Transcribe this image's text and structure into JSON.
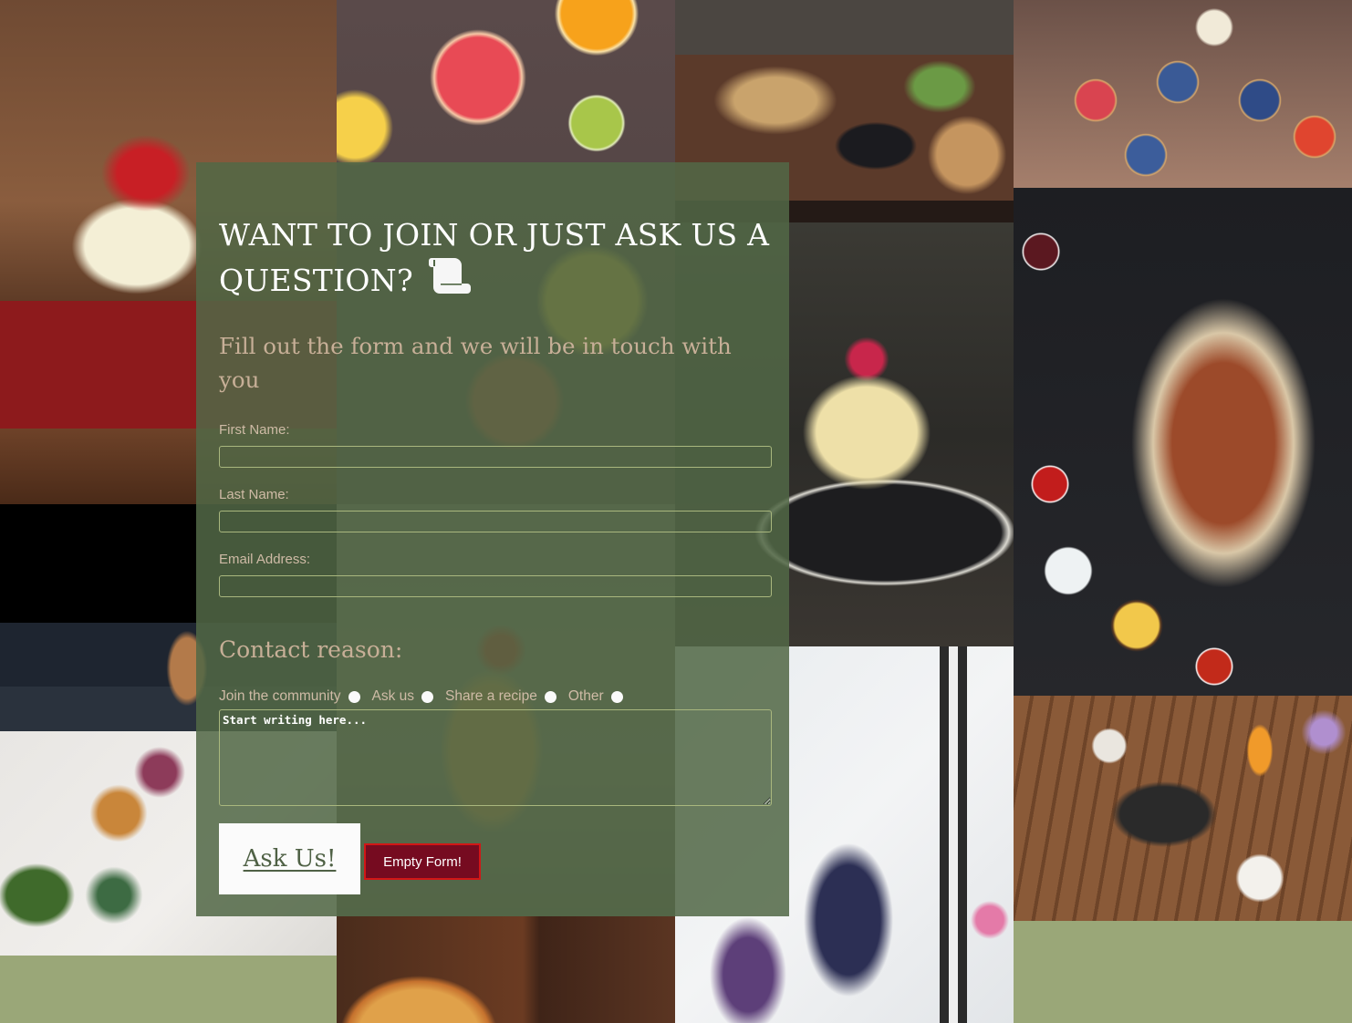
{
  "background": {
    "fill_color": "#9aa778",
    "tiles": [
      {
        "name": "red-velvet-cupcake-photo"
      },
      {
        "name": "burger-photo"
      },
      {
        "name": "breakfast-spread-photo"
      },
      {
        "name": "citrus-slices-photo"
      },
      {
        "name": "pancake-stack-photo"
      },
      {
        "name": "pizza-photo"
      },
      {
        "name": "grilled-platter-photo"
      },
      {
        "name": "raspberry-cake-photo"
      },
      {
        "name": "blueberry-cheesecake-photo"
      },
      {
        "name": "fruit-tarts-photo"
      },
      {
        "name": "kebab-platter-photo"
      },
      {
        "name": "dining-table-photo"
      }
    ]
  },
  "form": {
    "heading": "WANT TO JOIN OR JUST ASK US A QUESTION?",
    "heading_icon": "scroll-icon",
    "subheading": "Fill out the form and we will be in touch with you",
    "fields": [
      {
        "label": "First Name:",
        "value": "",
        "placeholder": ""
      },
      {
        "label": "Last Name:",
        "value": "",
        "placeholder": ""
      },
      {
        "label": "Email Address:",
        "value": "",
        "placeholder": ""
      }
    ],
    "contact_reason": {
      "title": "Contact reason:",
      "options": [
        {
          "label": "Join the community",
          "checked": false
        },
        {
          "label": "Ask us",
          "checked": false
        },
        {
          "label": "Share a recipe",
          "checked": false
        },
        {
          "label": "Other",
          "checked": false
        }
      ]
    },
    "message": {
      "value": "",
      "placeholder": "Start writing here..."
    },
    "submit_label": "Ask Us!",
    "reset_label": "Empty Form!"
  },
  "colors": {
    "panel": "#526846",
    "heading": "#ffffff",
    "accent_text": "#c7af97",
    "input_border": "#a9b77e",
    "reset_button": "#760b20",
    "reset_border": "#d21616",
    "submit_text": "#4f6145"
  }
}
